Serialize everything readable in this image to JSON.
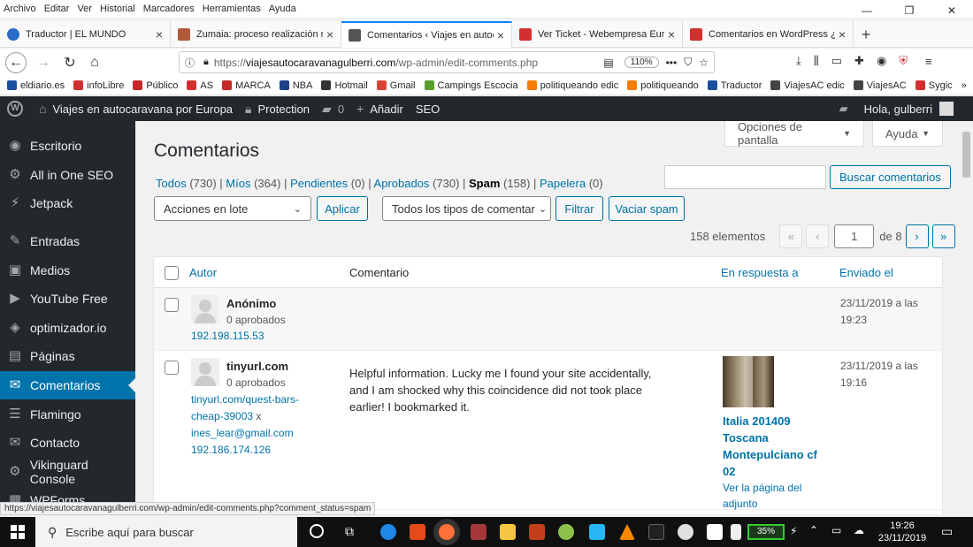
{
  "menubar": {
    "items": [
      "Archivo",
      "Editar",
      "Ver",
      "Historial",
      "Marcadores",
      "Herramientas",
      "Ayuda"
    ],
    "window_controls": [
      "—",
      "❐",
      "✕"
    ]
  },
  "tabs": [
    {
      "title": "Traductor | EL MUNDO",
      "color": "#2a6cc8"
    },
    {
      "title": "Zumaia: proceso realización nu",
      "color": "#b05a3a"
    },
    {
      "title": "Comentarios ‹ Viajes en autoca",
      "color": "#555555"
    },
    {
      "title": "Ver Ticket - Webempresa Europ",
      "color": "#d32f2f"
    },
    {
      "title": "Comentarios en WordPress ¿có",
      "color": "#d32f2f"
    }
  ],
  "navbar": {
    "back": "←",
    "forward": "→",
    "reload": "↻",
    "home": "⌂",
    "url_prefix": "https://",
    "url_domain": "viajesautocaravanagulberri.com",
    "url_path": "/wp-admin/edit-comments.php",
    "zoom": "110%",
    "more": "•••"
  },
  "bookmarks": [
    {
      "label": "eldiario.es",
      "color": "#1a4fa0"
    },
    {
      "label": "infoLibre",
      "color": "#d32f2f"
    },
    {
      "label": "Público",
      "color": "#c62828"
    },
    {
      "label": "AS",
      "color": "#d32f2f"
    },
    {
      "label": "MARCA",
      "color": "#c62828"
    },
    {
      "label": "NBA",
      "color": "#1d428a"
    },
    {
      "label": "Hotmail",
      "color": "#333333"
    },
    {
      "label": "Gmail",
      "color": "#d44638"
    },
    {
      "label": "Campings Escocia",
      "color": "#5a9e2a"
    },
    {
      "label": "politiqueando edic",
      "color": "#f57c00"
    },
    {
      "label": "politiqueando",
      "color": "#f57c00"
    },
    {
      "label": "Traductor",
      "color": "#1a4fa0"
    },
    {
      "label": "ViajesAC edic",
      "color": "#444444"
    },
    {
      "label": "ViajesAC",
      "color": "#444444"
    },
    {
      "label": "Sygic",
      "color": "#d32f2f"
    }
  ],
  "wpbar": {
    "site": "Viajes en autocaravana por Europa",
    "protection": "Protection",
    "comments_count": "0",
    "new": "Añadir",
    "seo": "SEO",
    "greeting": "Hola, gulberri"
  },
  "sidebar": [
    {
      "label": "Escritorio",
      "icon": "dashboard-icon",
      "glyph": "◉"
    },
    {
      "label": "All in One SEO",
      "icon": "gear-icon",
      "glyph": "⚙"
    },
    {
      "label": "Jetpack",
      "icon": "jetpack-icon",
      "glyph": "⚡"
    },
    {
      "label": "Entradas",
      "icon": "pin-icon",
      "glyph": "✎"
    },
    {
      "label": "Medios",
      "icon": "media-icon",
      "glyph": "▣"
    },
    {
      "label": "YouTube Free",
      "icon": "youtube-icon",
      "glyph": "▶"
    },
    {
      "label": "optimizador.io",
      "icon": "optimizer-icon",
      "glyph": "◈"
    },
    {
      "label": "Páginas",
      "icon": "pages-icon",
      "glyph": "▤"
    },
    {
      "label": "Comentarios",
      "icon": "comments-icon",
      "glyph": "✉"
    },
    {
      "label": "Flamingo",
      "icon": "flamingo-icon",
      "glyph": "☰"
    },
    {
      "label": "Contacto",
      "icon": "mail-icon",
      "glyph": "✉"
    },
    {
      "label": "Vikinguard Console",
      "icon": "vikinguard-icon",
      "glyph": "⚙"
    },
    {
      "label": "WPForms",
      "icon": "forms-icon",
      "glyph": "▦"
    }
  ],
  "screen_options": "Opciones de pantalla",
  "help": "Ayuda",
  "page_title": "Comentarios",
  "filters": [
    {
      "label": "Todos",
      "count": "(730)"
    },
    {
      "label": "Míos",
      "count": "(364)"
    },
    {
      "label": "Pendientes",
      "count": "(0)"
    },
    {
      "label": "Aprobados",
      "count": "(730)"
    },
    {
      "label": "Spam",
      "count": "(158)"
    },
    {
      "label": "Papelera",
      "count": "(0)"
    }
  ],
  "search_button": "Buscar comentarios",
  "bulk_actions": "Acciones en lote",
  "apply": "Aplicar",
  "comment_types": "Todos los tipos de comentar",
  "filter": "Filtrar",
  "empty_spam": "Vaciar spam",
  "pagination": {
    "items": "158 elementos",
    "first": "«",
    "prev": "‹",
    "current": "1",
    "of": "de 8",
    "next": "›",
    "last": "»"
  },
  "columns": {
    "author": "Autor",
    "comment": "Comentario",
    "response": "En respuesta a",
    "date": "Enviado el"
  },
  "rows": [
    {
      "author": "Anónimo",
      "approved": "0 aprobados",
      "ip": "192.198.115.53",
      "date": "23/11/2019 a las",
      "time": "19:23"
    },
    {
      "author": "tinyurl.com",
      "approved": "0 aprobados",
      "url1": "tinyurl.com/quest-bars-",
      "url2": "cheap-39003",
      "x": "x",
      "email": "ines_lear@gmail.com",
      "ip": "192.186.174.126",
      "comment1": "Helpful information. Lucky me I found your site accidentally,",
      "comment2": "and I am shocked why this coincidence did not took place",
      "comment3": "earlier! I bookmarked it.",
      "post1": "Italia 201409",
      "post2": "Toscana",
      "post3": "Montepulciano cf",
      "post4": "02",
      "view1": "Ver la página del",
      "view2": "adjunto",
      "date": "23/11/2019 a las",
      "time": "19:16"
    }
  ],
  "status_url": "https://viajesautocaravanagulberri.com/wp-admin/edit-comments.php?comment_status=spam",
  "taskbar": {
    "search": "Escribe aquí para buscar",
    "battery": "35%",
    "time": "19:26",
    "date": "23/11/2019"
  }
}
